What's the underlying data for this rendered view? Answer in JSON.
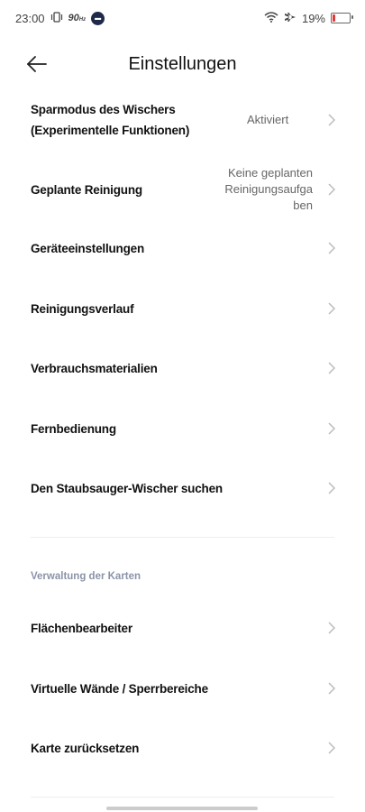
{
  "status_bar": {
    "time": "23:00",
    "refresh_rate": "90",
    "refresh_unit": "Hz",
    "battery_percent": "19%",
    "battery_level": 0.19,
    "battery_color": "#e53935"
  },
  "header": {
    "title": "Einstellungen",
    "back_icon": "arrow-left-icon"
  },
  "items": {
    "wiper_saving": {
      "label": "Sparmodus des Wischers (Experimentelle Funktionen)",
      "value": "Aktiviert"
    },
    "scheduled_cleaning": {
      "label": "Geplante Reinigung",
      "value": "Keine geplanten Reinigungsaufgaben"
    },
    "device_settings": {
      "label": "Geräteeinstellungen"
    },
    "cleaning_history": {
      "label": "Reinigungsverlauf"
    },
    "consumables": {
      "label": "Verbrauchsmaterialien"
    },
    "remote_control": {
      "label": "Fernbedienung"
    },
    "find_vacuum": {
      "label": "Den Staubsauger-Wischer suchen"
    }
  },
  "maps_section": {
    "title": "Verwaltung der Karten",
    "area_editor": {
      "label": "Flächenbearbeiter"
    },
    "virtual_walls": {
      "label": "Virtuelle Wände / Sperrbereiche"
    },
    "reset_map": {
      "label": "Karte zurücksetzen"
    }
  },
  "colors": {
    "section_title": "#8a93a8",
    "chevron": "#bbbbbb"
  }
}
